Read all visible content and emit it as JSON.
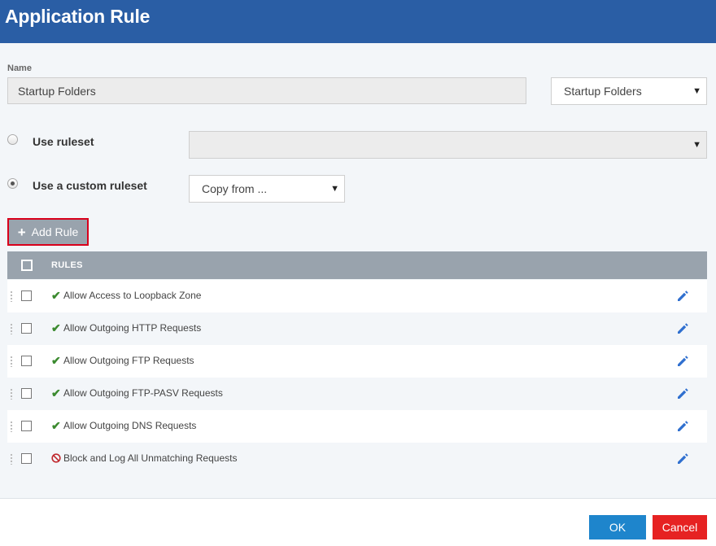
{
  "window": {
    "title": "Application Rule"
  },
  "name_field": {
    "label": "Name",
    "value": "Startup Folders"
  },
  "name_select": {
    "value": "Startup Folders",
    "icon": "caret-down-icon"
  },
  "ruleset_options": {
    "use_ruleset": {
      "label": "Use ruleset",
      "checked": false,
      "select_value": ""
    },
    "use_custom": {
      "label": "Use a custom ruleset",
      "checked": true,
      "copy_from": "Copy from ..."
    }
  },
  "add_rule": {
    "label": "Add Rule",
    "icon": "plus-icon"
  },
  "table": {
    "header": "RULES",
    "rows": [
      {
        "label": "Allow Access to Loopback Zone",
        "status": "allow",
        "icon": "check-icon"
      },
      {
        "label": "Allow Outgoing HTTP Requests",
        "status": "allow",
        "icon": "check-icon"
      },
      {
        "label": "Allow Outgoing FTP Requests",
        "status": "allow",
        "icon": "check-icon"
      },
      {
        "label": "Allow Outgoing FTP-PASV Requests",
        "status": "allow",
        "icon": "check-icon"
      },
      {
        "label": "Allow Outgoing DNS Requests",
        "status": "allow",
        "icon": "check-icon"
      },
      {
        "label": "Block and Log All Unmatching Requests",
        "status": "block",
        "icon": "block-icon"
      }
    ]
  },
  "footer": {
    "ok_label": "OK",
    "cancel_label": "Cancel"
  },
  "colors": {
    "title_bar": "#2a5ea5",
    "header_gray": "#99a3ad",
    "allow_green": "#3b8a2f",
    "block_red": "#c0282d",
    "ok_blue": "#1e85cc",
    "cancel_red": "#e62222",
    "highlight_border": "#d9001b"
  }
}
